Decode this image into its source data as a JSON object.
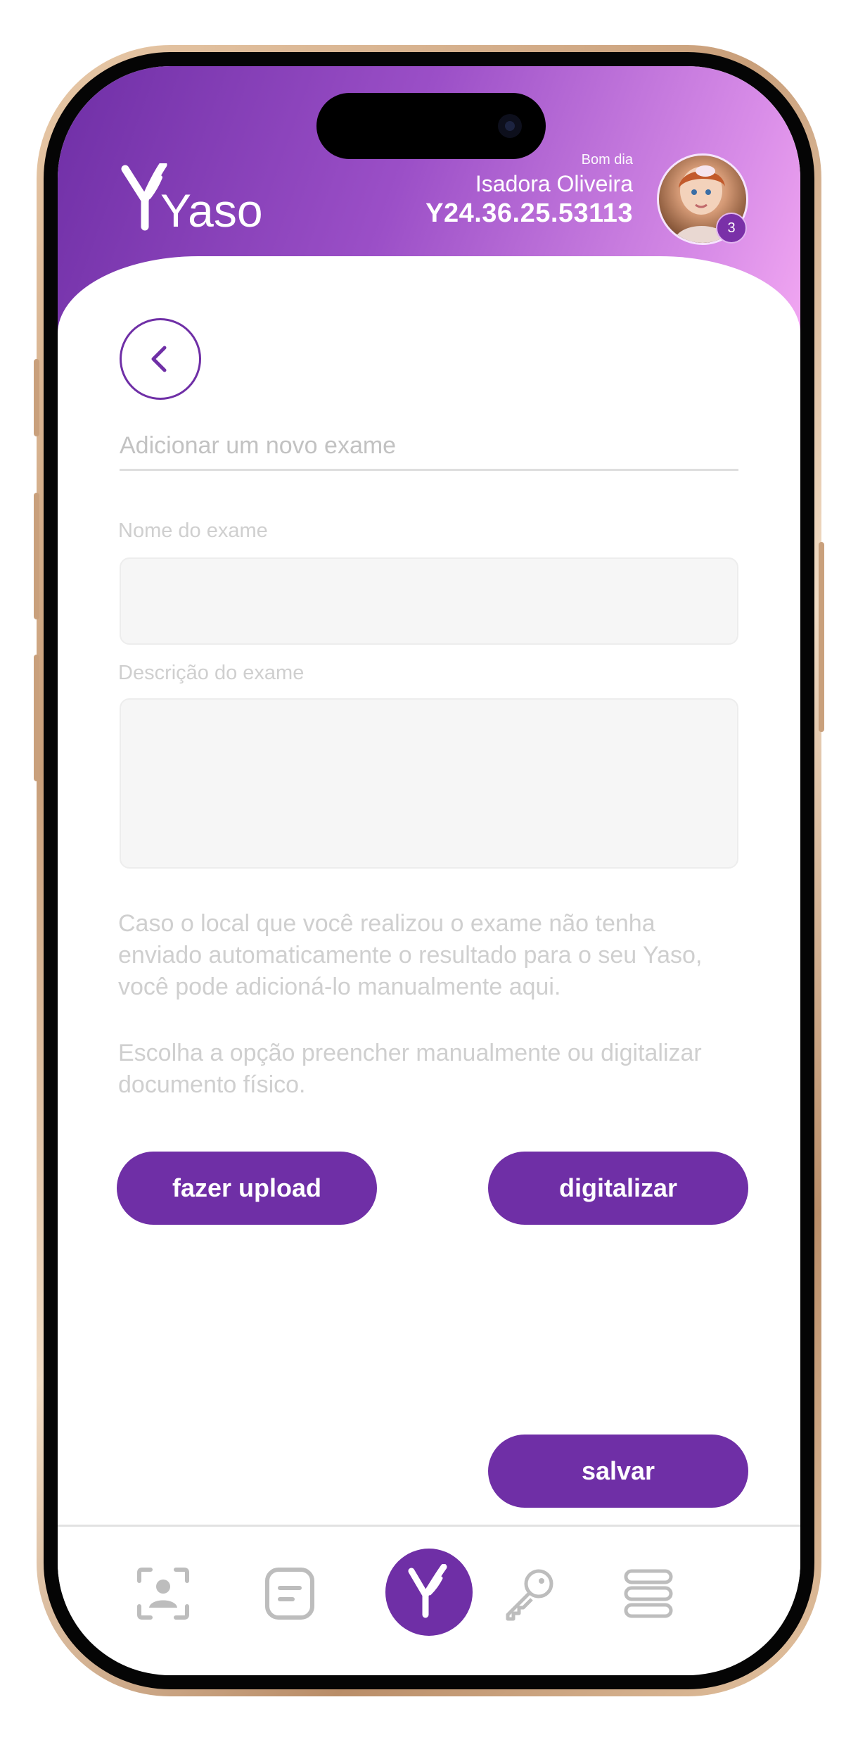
{
  "app": {
    "logo_text": "Yaso",
    "brand_color": "#6f2fa6"
  },
  "header": {
    "greeting": "Bom dia",
    "user_name": "Isadora Oliveira",
    "user_code": "Y24.36.25.53113",
    "notification_count": "3"
  },
  "form": {
    "title": "Adicionar um novo exame",
    "exam_name_label": "Nome do exame",
    "exam_name_value": "",
    "exam_description_label": "Descrição do exame",
    "exam_description_value": ""
  },
  "info": {
    "paragraph_1": "Caso o local que você realizou o exame não tenha enviado automaticamente o resultado para o seu Yaso, você pode adicioná-lo manualmente aqui.",
    "paragraph_2": "Escolha a opção preencher manualmente ou digitalizar documento físico."
  },
  "actions": {
    "upload_label": "fazer upload",
    "scan_label": "digitalizar",
    "save_label": "salvar"
  },
  "tabbar": {
    "items": [
      {
        "icon": "face-scan-icon"
      },
      {
        "icon": "document-icon"
      },
      {
        "icon": "yaso-home-icon"
      },
      {
        "icon": "key-icon"
      },
      {
        "icon": "menu-icon"
      }
    ]
  }
}
